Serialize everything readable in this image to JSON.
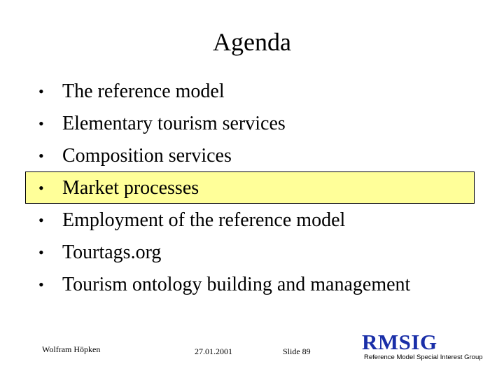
{
  "title": "Agenda",
  "agenda_items": [
    {
      "bullet": "•",
      "text": "The reference model",
      "highlighted": false
    },
    {
      "bullet": "•",
      "text": "Elementary tourism services",
      "highlighted": false
    },
    {
      "bullet": "•",
      "text": "Composition services",
      "highlighted": false
    },
    {
      "bullet": "•",
      "text": "Market processes",
      "highlighted": true
    },
    {
      "bullet": "•",
      "text": "Employment of the reference model",
      "highlighted": false
    },
    {
      "bullet": "•",
      "text": "Tourtags.org",
      "highlighted": false
    },
    {
      "bullet": "•",
      "text": "Tourism ontology building and management",
      "highlighted": false
    }
  ],
  "highlight_color": "#ffff99",
  "footer": {
    "author": "Wolfram Höpken",
    "date": "27.01.2001",
    "slide": "Slide 89",
    "logo": "RMSIG",
    "logo_subtitle": "Reference Model Special Interest Group",
    "logo_color": "#1a2fa8"
  }
}
